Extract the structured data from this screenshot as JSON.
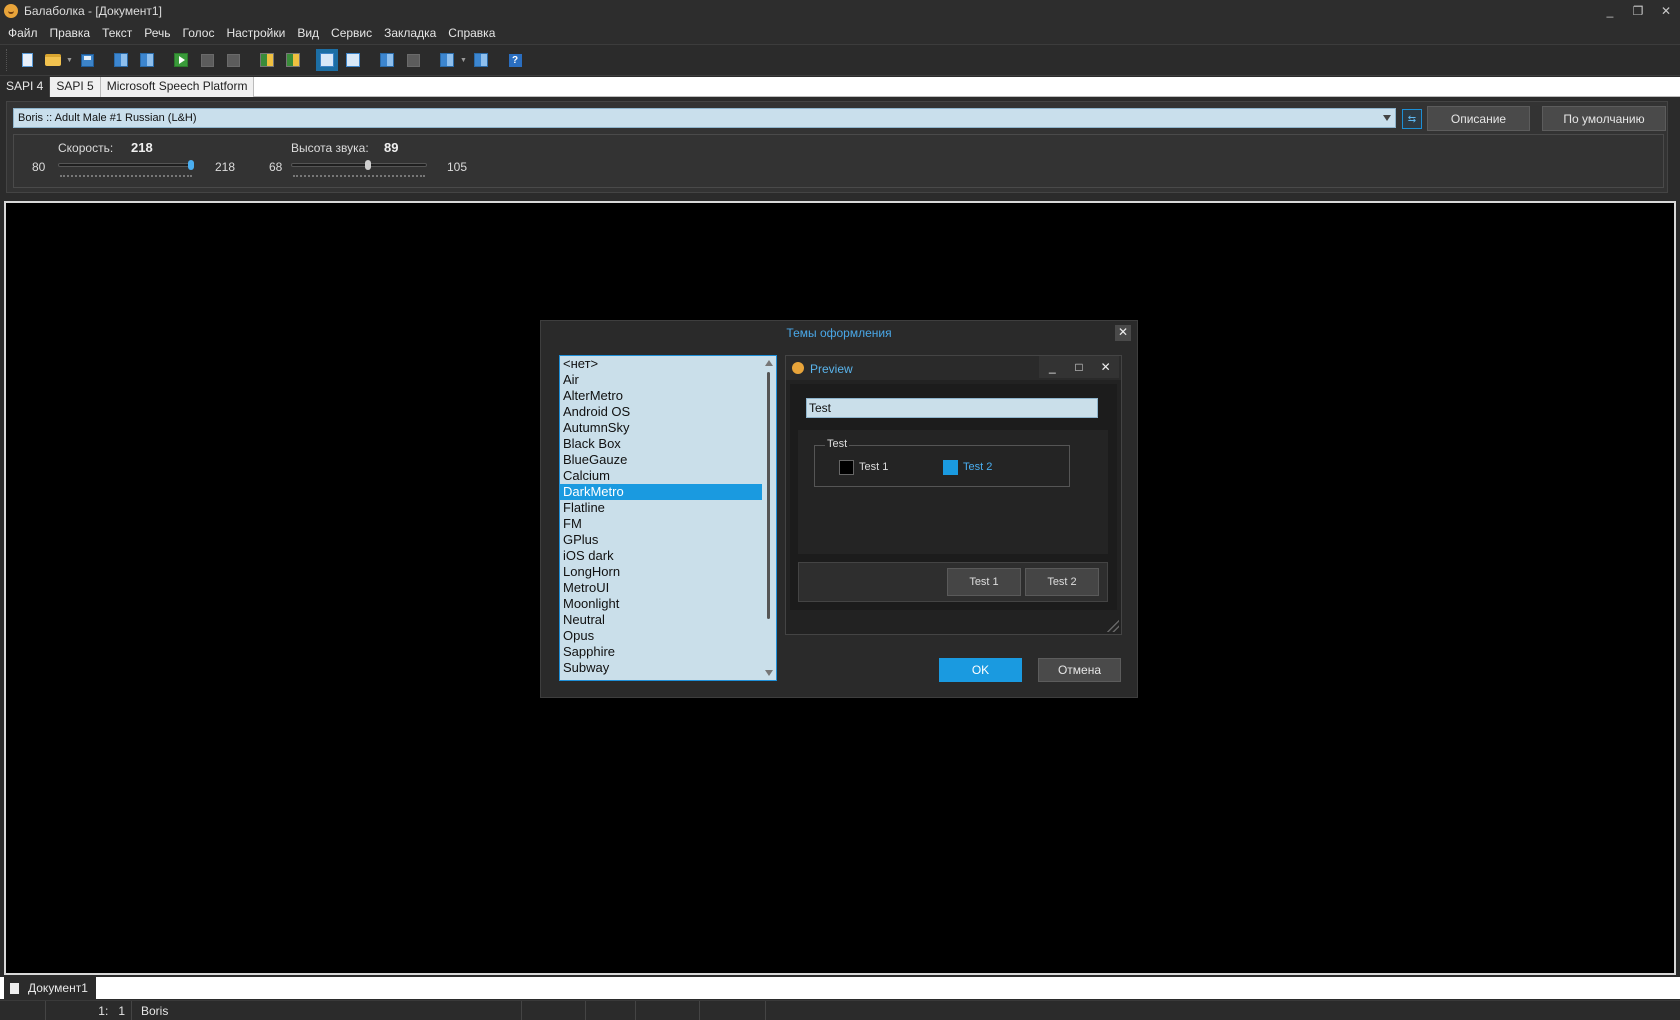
{
  "window": {
    "title": "Балаболка - [Документ1]",
    "controls": [
      "_",
      "❐",
      "✕"
    ]
  },
  "menu": [
    "Файл",
    "Правка",
    "Текст",
    "Речь",
    "Голос",
    "Настройки",
    "Вид",
    "Сервис",
    "Закладка",
    "Справка"
  ],
  "toolbar": {
    "icons": [
      "new-doc-icon",
      "open-folder-icon",
      "save-icon",
      "save-audio-icon",
      "split-icon",
      "play-icon",
      "pause-icon",
      "stop-icon",
      "read-clipboard-icon",
      "read-file-icon",
      "view-active-icon",
      "voice-icon",
      "compare-icon",
      "convert-icon",
      "dictionary-icon",
      "book-icon",
      "help-icon"
    ],
    "help_glyph": "?"
  },
  "sapi_tabs": [
    "SAPI 4",
    "SAPI 5",
    "Microsoft Speech Platform"
  ],
  "voice": {
    "selected": "Boris :: Adult Male #1 Russian (L&H)",
    "link_glyph": "⇆",
    "describe_label": "Описание",
    "default_label": "По умолчанию",
    "speed": {
      "label": "Скорость:",
      "value": "218",
      "min": "80",
      "max": "218",
      "level": 1.0
    },
    "pitch": {
      "label": "Высота звука:",
      "value": "89",
      "min": "68",
      "max": "105",
      "level": 0.57
    }
  },
  "dialog": {
    "title": "Темы оформления",
    "close_glyph": "✕",
    "themes": [
      "<нет>",
      "Air",
      "AlterMetro",
      "Android OS",
      "AutumnSky",
      "Black Box",
      "BlueGauze",
      "Calcium",
      "DarkMetro",
      "Flatline",
      "FM",
      "GPlus",
      "iOS dark",
      "LongHorn",
      "MetroUI",
      "Moonlight",
      "Neutral",
      "Opus",
      "Sapphire",
      "Subway"
    ],
    "selected_theme": "DarkMetro",
    "preview": {
      "title": "Preview",
      "ctrls": [
        "_",
        "□",
        "✕"
      ],
      "input_value": "Test",
      "group_label": "Test",
      "check1": "Test 1",
      "check2": "Test 2",
      "button1": "Test 1",
      "button2": "Test 2"
    },
    "ok_label": "OK",
    "cancel_label": "Отмена"
  },
  "doc_tab": "Документ1",
  "status": {
    "line": "1:",
    "col": "1",
    "voice": "Boris"
  },
  "colors": {
    "accent": "#1a9ae0",
    "list_bg": "#cadfea",
    "editor_bg": "#000000"
  }
}
